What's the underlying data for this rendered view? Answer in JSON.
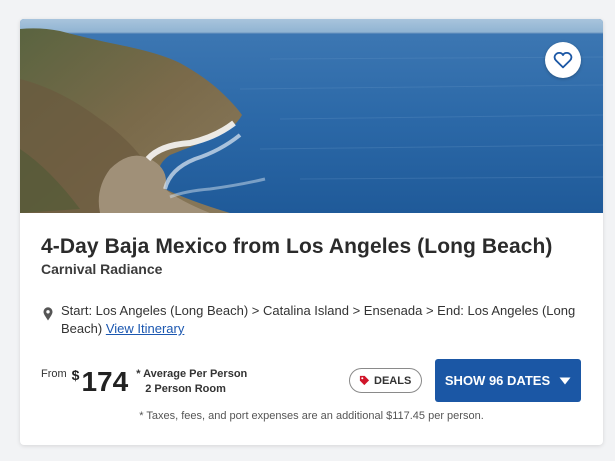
{
  "listing": {
    "title": "4-Day Baja Mexico from Los Angeles (Long Beach)",
    "ship": "Carnival Radiance",
    "itinerary_text": "Start: Los Angeles (Long Beach) > Catalina Island > Ensenada > End: Los Angeles (Long Beach)",
    "itinerary_link": "View Itinerary",
    "favorite_icon": "heart-icon",
    "location_icon": "map-pin-icon"
  },
  "pricing": {
    "from_label": "From",
    "currency": "$",
    "amount": "174",
    "note_1": "* Average Per Person",
    "note_2": "2 Person Room"
  },
  "actions": {
    "deals_label": "DEALS",
    "deals_icon": "tag-icon",
    "show_dates_label": "SHOW 96 DATES",
    "show_dates_icon": "caret-down-icon"
  },
  "disclaimer": "* Taxes, fees, and port expenses are an additional $117.45 per person.",
  "colors": {
    "primary_button": "#1b57a5",
    "link": "#1b57b0",
    "tag": "#d0152a"
  }
}
